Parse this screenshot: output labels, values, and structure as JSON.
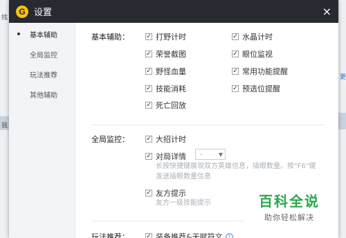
{
  "background": {
    "left_texts": [
      "找",
      "我"
    ],
    "right_text": "更"
  },
  "dialog": {
    "logo_letter": "G",
    "title": "设置",
    "close_glyph": "×"
  },
  "sidebar": {
    "items": [
      {
        "label": "基本辅助",
        "active": true
      },
      {
        "label": "全局监控",
        "active": false
      },
      {
        "label": "玩法推荐",
        "active": false
      },
      {
        "label": "其他辅助",
        "active": false
      }
    ]
  },
  "basic": {
    "label": "基本辅助：",
    "options": [
      {
        "label": "打野计时",
        "checked": true
      },
      {
        "label": "水晶计时",
        "checked": true
      },
      {
        "label": "荣誉截图",
        "checked": true
      },
      {
        "label": "眼位监视",
        "checked": true
      },
      {
        "label": "野怪血量",
        "checked": true
      },
      {
        "label": "常用功能提醒",
        "checked": true
      },
      {
        "label": "技能消耗",
        "checked": true
      },
      {
        "label": "预选位提醒",
        "checked": true
      },
      {
        "label": "死亡回放",
        "checked": true
      }
    ]
  },
  "monitor": {
    "label": "全局监控：",
    "ult_timer": {
      "label": "大招计时",
      "checked": true
    },
    "match_detail": {
      "label": "对局详情",
      "checked": true,
      "select_value": "-"
    },
    "match_desc_1": "长按快捷键展现双方英雄信息，插眼数量。按\"F6\"键",
    "match_desc_2": "发送插眼数量信息",
    "ally": {
      "label": "友方提示",
      "checked": true
    },
    "ally_desc": "友方一级技能提示"
  },
  "play": {
    "label": "玩法推荐：",
    "option": {
      "label": "装备推荐&天赋符文",
      "checked": true
    },
    "help_glyph": "?"
  },
  "watermark": {
    "main": "百科全说",
    "sub": "助你轻松解决"
  },
  "check_glyph": "✓"
}
